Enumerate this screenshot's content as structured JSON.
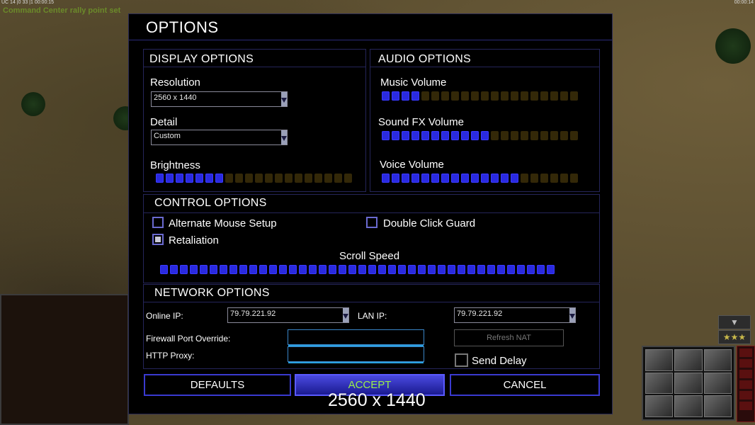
{
  "hud": {
    "left_status": "UC 14 |0 33 |1 00:00:15",
    "right_status": "00:00:14",
    "rally_message": "Command Center rally point set"
  },
  "dialog": {
    "title": "OPTIONS",
    "display": {
      "title": "DISPLAY OPTIONS",
      "resolution_label": "Resolution",
      "resolution_value": "2560 x 1440",
      "detail_label": "Detail",
      "detail_value": "Custom",
      "brightness_label": "Brightness",
      "brightness_level": 0.36
    },
    "audio": {
      "title": "AUDIO OPTIONS",
      "music_label": "Music Volume",
      "music_level": 0.2,
      "sfx_label": "Sound FX Volume",
      "sfx_level": 0.55,
      "voice_label": "Voice Volume",
      "voice_level": 0.7
    },
    "control": {
      "title": "CONTROL OPTIONS",
      "alt_mouse_label": "Alternate Mouse Setup",
      "alt_mouse_checked": false,
      "double_click_label": "Double Click Guard",
      "double_click_checked": false,
      "retaliation_label": "Retaliation",
      "retaliation_checked": true,
      "scroll_label": "Scroll Speed",
      "scroll_level": 1.0
    },
    "network": {
      "title": "NETWORK OPTIONS",
      "online_ip_label": "Online IP:",
      "online_ip_value": "79.79.221.92",
      "lan_ip_label": "LAN IP:",
      "lan_ip_value": "79.79.221.92",
      "firewall_label": "Firewall Port Override:",
      "firewall_value": "",
      "proxy_label": "HTTP Proxy:",
      "proxy_value": "",
      "refresh_nat_label": "Refresh NAT",
      "send_delay_label": "Send Delay",
      "send_delay_checked": false
    },
    "buttons": {
      "defaults": "DEFAULTS",
      "accept": "ACCEPT",
      "cancel": "CANCEL"
    }
  },
  "resolution_overlay": "2560 x 1440",
  "colors": {
    "slider_on": "#2a2ae0",
    "slider_off": "#332808",
    "accept_text": "#9af04a",
    "panel_border": "#25255a"
  }
}
